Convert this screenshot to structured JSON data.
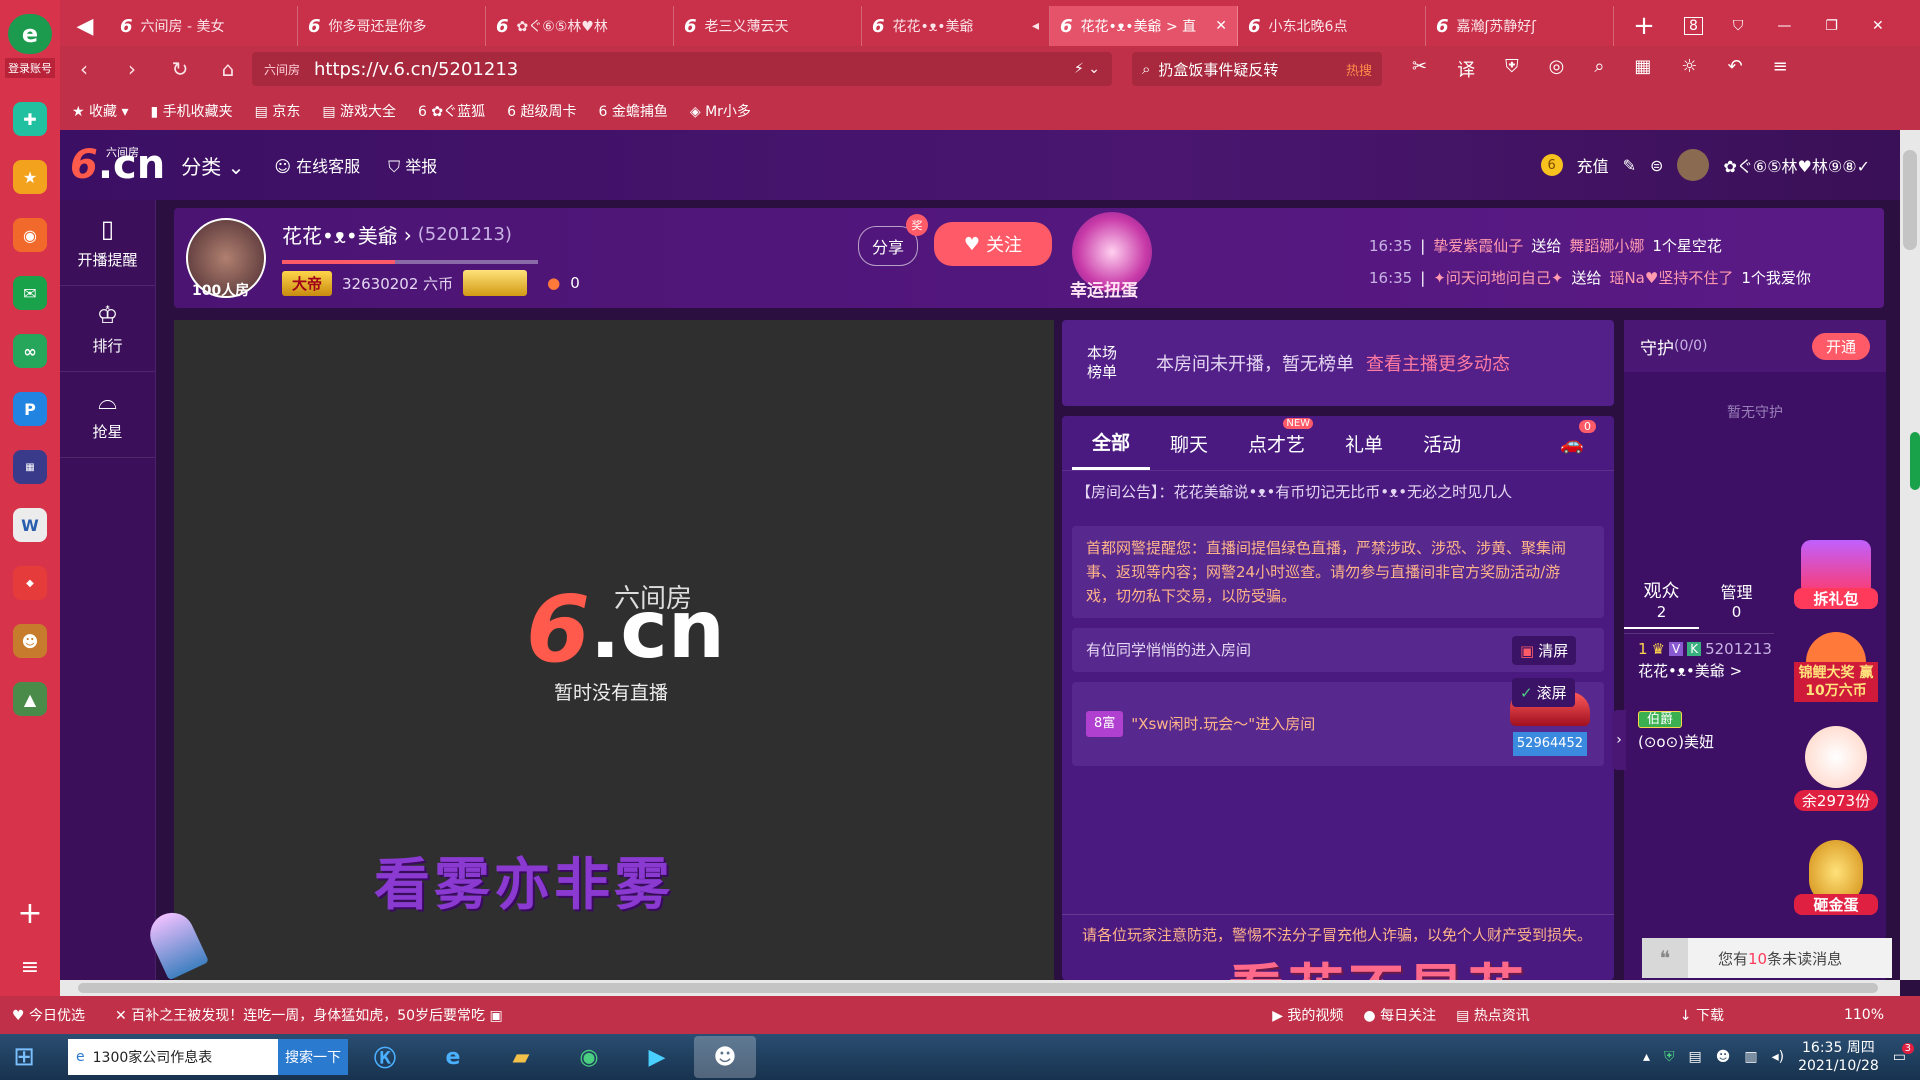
{
  "sidebar": {
    "login_label": "登录账号"
  },
  "tabs": [
    {
      "label": "六间房 - 美女"
    },
    {
      "label": "你多哥还是你多"
    },
    {
      "label": "✿ぐ⑥⑤林♥林"
    },
    {
      "label": "老三义薄云天"
    },
    {
      "label": "花花•ᴥ•美爺"
    },
    {
      "label": "花花•ᴥ•美爺 > 直"
    },
    {
      "label": "小东北晚6点"
    },
    {
      "label": "嘉瀚ʃ苏静好ʃ"
    }
  ],
  "tab_count": "8",
  "address": {
    "url": "https://v.6.cn/5201213",
    "site_tag": "六间房"
  },
  "search": {
    "text": "扔盒饭事件疑反转",
    "badge": "热搜"
  },
  "bookmarks": [
    "收藏",
    "手机收藏夹",
    "京东",
    "游戏大全",
    "✿ぐ蓝狐",
    "超级周卡",
    "金蟾捕鱼",
    "Mr小多"
  ],
  "site": {
    "logo_small": "六间房",
    "logo_num": "6",
    "logo_cn": ".cn",
    "category": "分类",
    "service": "在线客服",
    "report": "举报",
    "recharge": "充值",
    "username": "✿ぐ⑥⑤林♥林⑨⑧✓"
  },
  "side_nav": [
    {
      "label": "开播提醒"
    },
    {
      "label": "排行"
    },
    {
      "label": "抢星"
    }
  ],
  "anchor": {
    "name": "花花•ᴥ•美爺",
    "id": "(5201213)",
    "room_tag": "100人房",
    "rank_badge": "大帝",
    "coins": "32630202 六币",
    "fire_count": "0",
    "share": "分享",
    "share_badge": "奖",
    "follow": "关注",
    "lucky_egg": "幸运扭蛋"
  },
  "gift_feed": [
    {
      "time": "16:35",
      "from": "挚爱紫霞仙子",
      "action": "送给",
      "to": "舞蹈娜小娜",
      "gift": "1个星空花"
    },
    {
      "time": "16:35",
      "from": "✦问天问地问自己✦",
      "action": "送给",
      "to": "瑶Na♥坚持不住了",
      "gift": "1个我爱你"
    }
  ],
  "player": {
    "logo_small": "六间房",
    "logo_cn": ".cn",
    "no_live": "暂时没有直播",
    "overlay_text": "看雾亦非雾"
  },
  "rank_panel": {
    "title": "本场榜单",
    "empty": "本房间未开播，暂无榜单",
    "link": "查看主播更多动态"
  },
  "chat_tabs": [
    {
      "label": "全部"
    },
    {
      "label": "聊天"
    },
    {
      "label": "点才艺",
      "badge": "NEW"
    },
    {
      "label": "礼单"
    },
    {
      "label": "活动"
    }
  ],
  "car_badge": "0",
  "room_notice": "【房间公告】：花花美爺说•ᴥ•有币切记无比币•ᴥ•无必之时见几人",
  "police_notice": "首都网警提醒您：直播间提倡绿色直播，严禁涉政、涉恐、涉黄、聚集闹事、返现等内容；网警24小时巡查。请勿参与直播间非官方奖励活动/游戏，切勿私下交易，以防受骗。",
  "enter_msg": "有位同学悄悄的进入房间",
  "clear_btn": "清屏",
  "scroll_btn": "滚屏",
  "vip_enter": {
    "badge": "8富",
    "text": "\"Xsw闲时.玩会～\"进入房间",
    "car_id": "52964452"
  },
  "bottom_warning": "请各位玩家注意防范，警惕不法分子冒充他人诈骗，以免个人财产受到损失。",
  "bottom_overlay": "看花不是花",
  "guard": {
    "title": "守护",
    "count": "(0/0)",
    "open": "开通",
    "empty": "暂无守护"
  },
  "audience": {
    "label": "观众",
    "count": "2",
    "admin_label": "管理",
    "admin_count": "0"
  },
  "users": [
    {
      "rank": "1",
      "vip": "V",
      "k": "K",
      "id": "5201213",
      "name": "花花•ᴥ•美爺 >"
    },
    {
      "badge": "伯爵",
      "name": "(⊙o⊙)美妞"
    }
  ],
  "promos": [
    {
      "label": "拆礼包"
    },
    {
      "label": "锦鲤大奖 赢10万六币"
    },
    {
      "label": "余2973份"
    },
    {
      "label": "砸金蛋"
    }
  ],
  "unread": {
    "pre": "您有",
    "num": "10",
    "post": "条未读消息"
  },
  "statusbar": {
    "today": "今日优选",
    "news": "百补之王被发现！连吃一周，身体猛如虎，50岁后要常吃",
    "video": "我的视频",
    "follow": "每日关注",
    "hot": "热点资讯",
    "download": "下载",
    "zoom": "110%"
  },
  "taskbar": {
    "app_label": "1300家公司作息表",
    "search_btn": "搜索一下",
    "time": "16:35 周四",
    "date": "2021/10/28",
    "notif": "3"
  },
  "colors": {
    "accent": "#ff5a67",
    "browser": "#c9304a",
    "site_bg": "#3b0f5a"
  }
}
